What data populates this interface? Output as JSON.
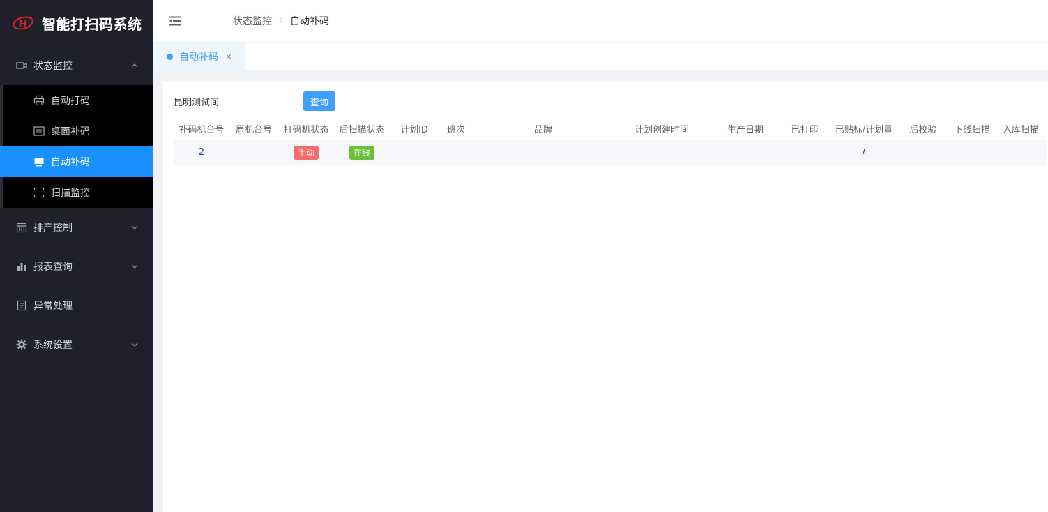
{
  "app": {
    "title": "智能打扫码系统",
    "logo_letter": "H"
  },
  "colors": {
    "sidebar_bg": "#1f2029",
    "accent": "#1890ff",
    "tag_manual": "#f56c6c",
    "tag_online": "#67c23a"
  },
  "sidebar": {
    "menus": [
      {
        "label": "状态监控",
        "icon": "video-camera-icon",
        "expanded": true,
        "children": [
          {
            "label": "自动打码",
            "icon": "printer-icon",
            "active": false
          },
          {
            "label": "桌面补码",
            "icon": "barcode-icon",
            "active": false
          },
          {
            "label": "自动补码",
            "icon": "monitor-icon",
            "active": true
          },
          {
            "label": "扫描监控",
            "icon": "scan-frame-icon",
            "active": false
          }
        ]
      },
      {
        "label": "排产控制",
        "icon": "calendar-icon",
        "expanded": false
      },
      {
        "label": "报表查询",
        "icon": "bar-chart-icon",
        "expanded": false
      },
      {
        "label": "异常处理",
        "icon": "document-icon"
      },
      {
        "label": "系统设置",
        "icon": "gear-icon",
        "expanded": false
      }
    ]
  },
  "header": {
    "breadcrumb": [
      "状态监控",
      "自动补码"
    ]
  },
  "tabs": [
    {
      "label": "自动补码",
      "close": "×"
    }
  ],
  "filter": {
    "label": "昆明测试间",
    "query_button": "查询"
  },
  "table": {
    "columns": [
      "补码机台号",
      "原机台号",
      "打码机状态",
      "后扫描状态",
      "计划ID",
      "班次",
      "品牌",
      "计划创建时间",
      "生产日期",
      "已打印",
      "已贴标/计划量",
      "后校验",
      "下线扫描",
      "入库扫描"
    ],
    "rows": [
      {
        "machine_no": "2",
        "orig_machine": "",
        "printer_status": "手动",
        "scan_status": "在线",
        "plan_id": "",
        "shift": "",
        "brand": "",
        "created": "",
        "prod_date": "",
        "printed": "",
        "labeled_plan": "/",
        "post_check": "",
        "offline_scan": "",
        "storage_scan": ""
      }
    ]
  }
}
